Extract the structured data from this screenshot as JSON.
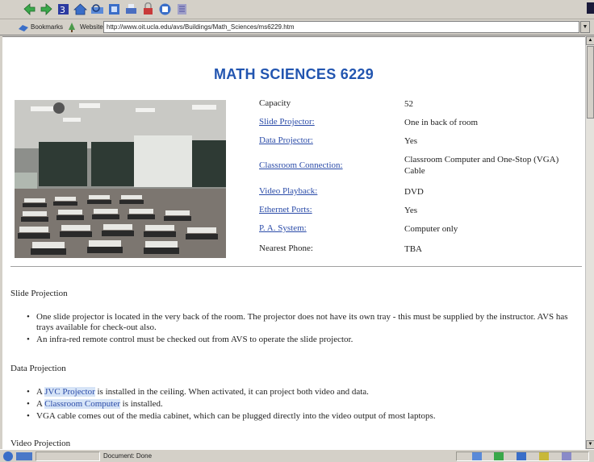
{
  "browser": {
    "toolbar_icons": [
      "back-icon",
      "forward-icon",
      "stop-icon",
      "home-icon",
      "search-icon",
      "bookmarks-icon",
      "print-icon",
      "security-icon",
      "reload-icon",
      "shop-icon"
    ],
    "bookmarks_label": "Bookmarks",
    "website_label": "Website:",
    "address": "http://www.oit.ucla.edu/avs/Buildings/Math_Sciences/ms6229.htm",
    "status_text": "Document: Done"
  },
  "page": {
    "title": "MATH SCIENCES 6229",
    "specs": [
      {
        "label": "Capacity",
        "value": "52",
        "link": false
      },
      {
        "label": "Slide Projector:",
        "value": "One in back of room",
        "link": true
      },
      {
        "label": "Data Projector:",
        "value": "Yes",
        "link": true
      },
      {
        "label": "Classroom Connection:",
        "value": "Classroom Computer and One-Stop (VGA) Cable",
        "link": true
      },
      {
        "label": "Video Playback:",
        "value": "DVD",
        "link": true
      },
      {
        "label": "Ethernet Ports:",
        "value": "Yes",
        "link": true
      },
      {
        "label": "P. A. System:",
        "value": "Computer only",
        "link": true
      },
      {
        "label": "Nearest Phone:",
        "value": "TBA",
        "link": false
      }
    ],
    "slide_projection": {
      "heading": "Slide Projection",
      "items": [
        "One slide projector is located in the very back of the room. The projector does not have its own tray - this must be supplied by the instructor. AVS has trays available for check-out also.",
        "An infra-red remote control must be checked out from AVS to operate the slide projector."
      ]
    },
    "data_projection": {
      "heading": "Data Projection",
      "item1_prefix": "A ",
      "item1_link": "JVC Projector",
      "item1_suffix": " is installed in the ceiling. When activated, it can project both video and data.",
      "item2_prefix": "A ",
      "item2_link": "Classroom Computer",
      "item2_suffix": " is installed.",
      "item3": "VGA cable comes out of the media cabinet, which can be plugged directly into the video output of most laptops."
    },
    "video_projection": {
      "heading": "Video Projection"
    }
  },
  "colors": {
    "title": "#2255b0",
    "link": "#2a4ba8",
    "link_highlight": "#d6e4f7"
  }
}
